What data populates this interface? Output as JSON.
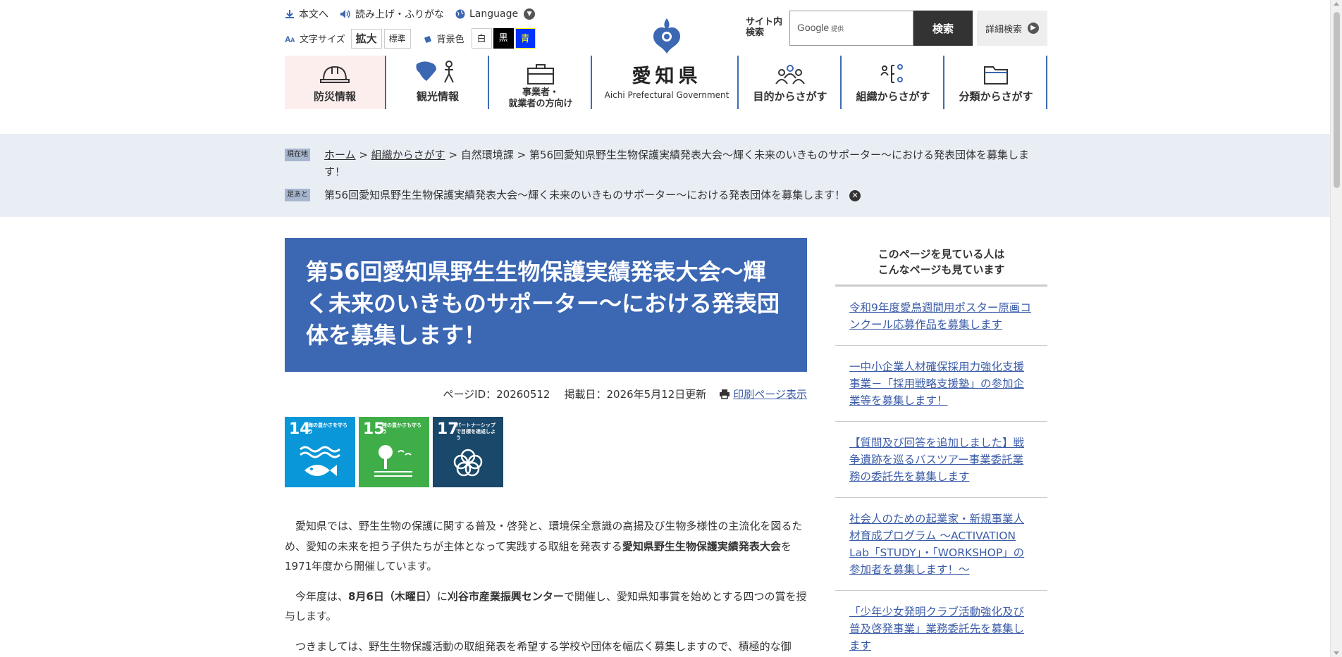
{
  "header": {
    "skip_to_main": "本文へ",
    "read_aloud": "読み上げ・ふりがな",
    "language": "Language",
    "font_size_label": "文字サイズ",
    "font_size_large": "拡大",
    "font_size_standard": "標準",
    "bg_color_label": "背景色",
    "bg_white": "白",
    "bg_black": "黒",
    "bg_blue": "青",
    "logo_name": "愛知県",
    "logo_en": "Aichi Prefectural Government",
    "search_label_line1": "サイト内",
    "search_label_line2": "検索",
    "search_google": "Google",
    "search_provided": "提供",
    "search_button": "検索",
    "advanced_search": "詳細検索"
  },
  "gnav": {
    "disaster": "防災情報",
    "tourism": "観光情報",
    "business_line1": "事業者・",
    "business_line2": "就業者の方向け",
    "purpose": "目的からさがす",
    "organization": "組織からさがす",
    "category": "分類からさがす"
  },
  "breadcrumb": {
    "current_tag": "現在地",
    "home": "ホーム",
    "org": "組織からさがす",
    "dept": "自然環境課",
    "page": "第56回愛知県野生生物保護実績発表大会～輝く未来のいきものサポーター～における発表団体を募集します！",
    "history_tag": "足あと",
    "history_item": "第56回愛知県野生生物保護実績発表大会～輝く未来のいきものサポーター～における発表団体を募集します！"
  },
  "main": {
    "title": "第56回愛知県野生生物保護実績発表大会～輝く未来のいきものサポーター～における発表団体を募集します！",
    "page_id": "ページID：20260512",
    "published": "掲載日：2026年5月12日更新",
    "print_link": "印刷ページ表示",
    "sdgs": [
      {
        "num": "14",
        "text": "海の豊かさを守ろう",
        "color": "#0a97d9"
      },
      {
        "num": "15",
        "text": "陸の豊かさも守ろう",
        "color": "#3fae49"
      },
      {
        "num": "17",
        "text": "パートナーシップで目標を達成しよう",
        "color": "#19486a"
      }
    ],
    "p1_a": "愛知県では、野生生物の保護に関する普及・啓発と、環境保全意識の高揚及び生物多様性の主流化を図るため、愛知の未来を担う子供たちが主体となって実践する取組を発表する",
    "p1_b": "愛知県野生生物保護実績発表大会",
    "p1_c": "を1971年度から開催しています。",
    "p2_a": "今年度は、",
    "p2_b": "8月6日（木曜日）",
    "p2_c": "に",
    "p2_d": "刈谷市産業振興センター",
    "p2_e": "で開催し、愛知県知事賞を始めとする四つの賞を授与します。",
    "p3": "つきましては、野生生物保護活動の取組発表を希望する学校や団体を幅広く募集しますので、積極的な御"
  },
  "sidebar": {
    "head_line1": "このページを見ている人は",
    "head_line2": "こんなページも見ています",
    "links": [
      "令和9年度愛鳥週間用ポスター原画コンクール応募作品を募集します",
      "一中小企業人材確保採用力強化支援事業－「採用戦略支援塾」の参加企業等を募集します！",
      "【質問及び回答を追加しました】戦争遺跡を巡るバスツアー事業委託業務の委託先を募集します",
      "社会人のための起業家・新規事業人材育成プログラム ～ACTIVATION Lab「STUDY」・「WORKSHOP」の参加者を募集します！～",
      "「少年少女発明クラブ活動強化及び普及啓発事業」業務委託先を募集します"
    ]
  },
  "colors": {
    "accent_blue": "#3b67b3",
    "link": "#3b5ca8",
    "crumb_bg": "#e9eef5"
  }
}
